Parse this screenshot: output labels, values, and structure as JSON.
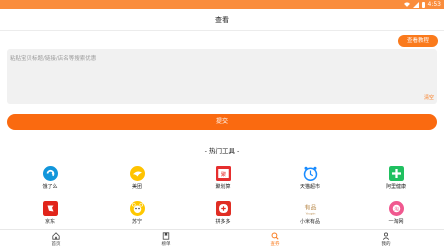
{
  "status_bar": {
    "time": "4:53",
    "color": "#fa8d3c",
    "icons": [
      "wifi-icon",
      "signal-icon",
      "battery-icon"
    ]
  },
  "header": {
    "title": "查看"
  },
  "query_button": {
    "label": "查看教程"
  },
  "input": {
    "placeholder": "粘贴宝贝标题/链接/店名等搜索优惠",
    "clear_label": "清空"
  },
  "submit_button": {
    "label": "提交"
  },
  "tools_section": {
    "title": "- 热门工具 -"
  },
  "tools": [
    {
      "label": "饿了么",
      "icon": "eleme-icon",
      "color": "#1296db"
    },
    {
      "label": "美团",
      "icon": "meituan-icon",
      "color": "#ffc300"
    },
    {
      "label": "聚划算",
      "icon": "juhuasuan-icon",
      "color": "#e62e2e"
    },
    {
      "label": "天猫超市",
      "icon": "tmall-clock-icon",
      "color": "#1a8cff"
    },
    {
      "label": "阿里健康",
      "icon": "alihealth-icon",
      "color": "#20c060"
    },
    {
      "label": "京东",
      "icon": "jd-icon",
      "color": "#e1251b"
    },
    {
      "label": "苏宁",
      "icon": "suning-icon",
      "color": "#ffc800"
    },
    {
      "label": "拼多多",
      "icon": "pinduoduo-icon",
      "color": "#e02e24"
    },
    {
      "label": "小米有品",
      "icon": "youpin-icon",
      "color": "#b8894a"
    },
    {
      "label": "一淘网",
      "icon": "etao-icon",
      "color": "#f0588f"
    }
  ],
  "bottom_nav": [
    {
      "label": "首页",
      "icon": "home-icon",
      "active": false
    },
    {
      "label": "榜单",
      "icon": "bookmark-icon",
      "active": false
    },
    {
      "label": "查券",
      "icon": "search-icon",
      "active": true
    },
    {
      "label": "我的",
      "icon": "user-icon",
      "active": false
    }
  ],
  "colors": {
    "accent": "#fa6a10",
    "accent_light": "#fa7a1c"
  }
}
